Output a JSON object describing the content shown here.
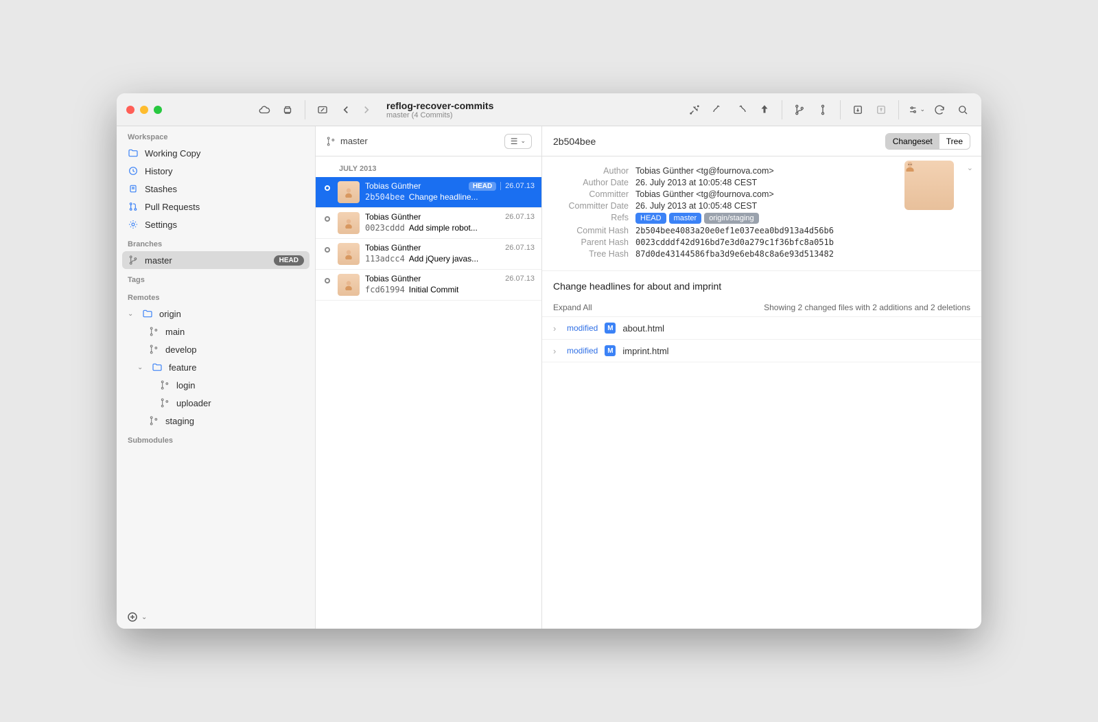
{
  "titlebar": {
    "repo_name": "reflog-recover-commits",
    "repo_sub": "master (4 Commits)"
  },
  "sidebar": {
    "workspace_title": "Workspace",
    "workspace": [
      {
        "label": "Working Copy"
      },
      {
        "label": "History"
      },
      {
        "label": "Stashes"
      },
      {
        "label": "Pull Requests"
      },
      {
        "label": "Settings"
      }
    ],
    "branches_title": "Branches",
    "branches": [
      {
        "label": "master",
        "head": "HEAD"
      }
    ],
    "tags_title": "Tags",
    "remotes_title": "Remotes",
    "remotes": {
      "origin": "origin",
      "main": "main",
      "develop": "develop",
      "feature": "feature",
      "login": "login",
      "uploader": "uploader",
      "staging": "staging"
    },
    "submodules_title": "Submodules"
  },
  "middle": {
    "branch_name": "master",
    "month": "JULY 2013",
    "commits": [
      {
        "author": "Tobias Günther",
        "date": "26.07.13",
        "hash": "2b504bee",
        "msg": "Change headline...",
        "head": "HEAD"
      },
      {
        "author": "Tobias Günther",
        "date": "26.07.13",
        "hash": "0023cddd",
        "msg": "Add simple robot..."
      },
      {
        "author": "Tobias Günther",
        "date": "26.07.13",
        "hash": "113adcc4",
        "msg": "Add jQuery javas..."
      },
      {
        "author": "Tobias Günther",
        "date": "26.07.13",
        "hash": "fcd61994",
        "msg": "Initial Commit"
      }
    ]
  },
  "detail": {
    "header_hash": "2b504bee",
    "seg_changeset": "Changeset",
    "seg_tree": "Tree",
    "meta": {
      "author_label": "Author",
      "author": "Tobias Günther <tg@fournova.com>",
      "author_date_label": "Author Date",
      "author_date": "26. July 2013 at 10:05:48 CEST",
      "committer_label": "Committer",
      "committer": "Tobias Günther <tg@fournova.com>",
      "committer_date_label": "Committer Date",
      "committer_date": "26. July 2013 at 10:05:48 CEST",
      "refs_label": "Refs",
      "ref_head": "HEAD",
      "ref_master": "master",
      "ref_remote": "origin/staging",
      "commit_hash_label": "Commit Hash",
      "commit_hash": "2b504bee4083a20e0ef1e037eea0bd913a4d56b6",
      "parent_hash_label": "Parent Hash",
      "parent_hash": "0023cdddf42d916bd7e3d0a279c1f36bfc8a051b",
      "tree_hash_label": "Tree Hash",
      "tree_hash": "87d0de43144586fba3d9e6eb48c8a6e93d513482"
    },
    "commit_title": "Change headlines for about and imprint",
    "expand_all": "Expand All",
    "summary": "Showing 2 changed files with 2 additions and 2 deletions",
    "files": [
      {
        "status": "modified",
        "badge": "M",
        "name": "about.html"
      },
      {
        "status": "modified",
        "badge": "M",
        "name": "imprint.html"
      }
    ]
  }
}
